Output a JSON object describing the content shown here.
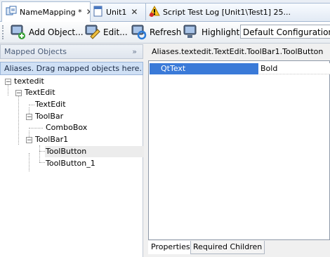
{
  "tabs": [
    {
      "label": "NameMapping *",
      "close": "✕",
      "icon": "namemapping-icon"
    },
    {
      "label": "Unit1",
      "close": "✕",
      "icon": "unit-icon"
    },
    {
      "label": "Script Test Log [Unit1\\Test1] 25...",
      "close": "",
      "icon": "warning-log-icon"
    }
  ],
  "toolbar": {
    "add_label": "Add Object...",
    "edit_label": "Edit...",
    "refresh_label": "Refresh",
    "highlight_label": "Highlight",
    "configuration_value": "Default Configuration"
  },
  "left_panel": {
    "title": "Mapped Objects",
    "collapse_glyph": "»",
    "hint": "Aliases. Drag mapped objects here.",
    "tree": [
      {
        "label": "textedit",
        "expander": "−"
      },
      {
        "label": "TextEdit",
        "expander": "−"
      },
      {
        "label": "TextEdit",
        "expander": ""
      },
      {
        "label": "ToolBar",
        "expander": "−"
      },
      {
        "label": "ComboBox",
        "expander": ""
      },
      {
        "label": "ToolBar1",
        "expander": "−"
      },
      {
        "label": "ToolButton",
        "expander": ""
      },
      {
        "label": "ToolButton_1",
        "expander": ""
      }
    ]
  },
  "right_panel": {
    "path": "Aliases.textedit.TextEdit.ToolBar1.ToolButton",
    "properties": [
      {
        "name": "QtText",
        "value": "Bold"
      }
    ],
    "bottom_tabs": [
      "Properties",
      "Required Children"
    ]
  },
  "colors": {
    "selection": "#3a7ad8",
    "hint_bg": "#cfe0f5"
  }
}
